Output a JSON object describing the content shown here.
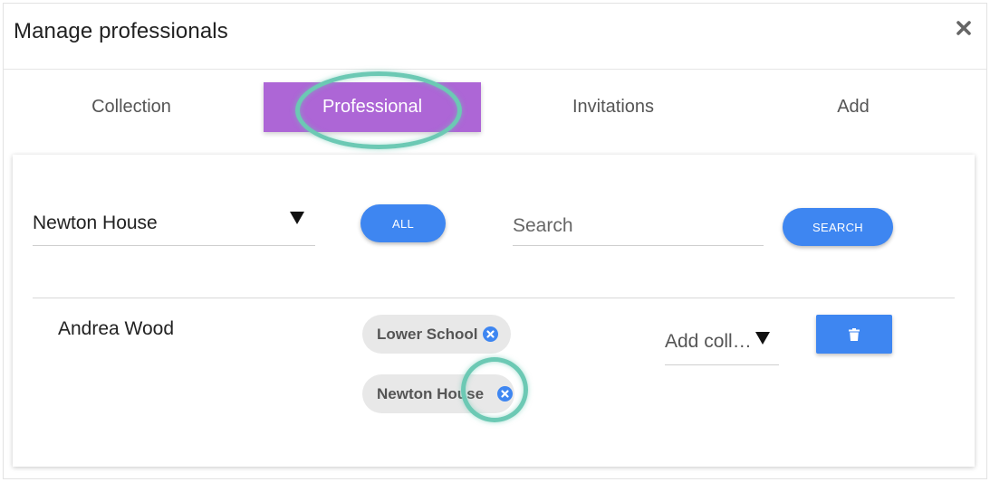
{
  "modal": {
    "title": "Manage professionals",
    "close_icon": "close-icon"
  },
  "tabs": [
    {
      "label": "Collection",
      "active": false
    },
    {
      "label": "Professional",
      "active": true
    },
    {
      "label": "Invitations",
      "active": false
    },
    {
      "label": "Add",
      "active": false
    }
  ],
  "filters": {
    "collection_select": "Newton House",
    "all_button": "ALL",
    "search_placeholder": "Search",
    "search_button": "SEARCH"
  },
  "professionals": [
    {
      "name": "Andrea Wood",
      "collections": [
        "Lower School",
        "Newton House"
      ],
      "add_collection_placeholder": "Add coll…"
    }
  ],
  "colors": {
    "accent_tab": "#ad66d6",
    "primary_button": "#3e86f1",
    "highlight": "#6cc9b4"
  }
}
